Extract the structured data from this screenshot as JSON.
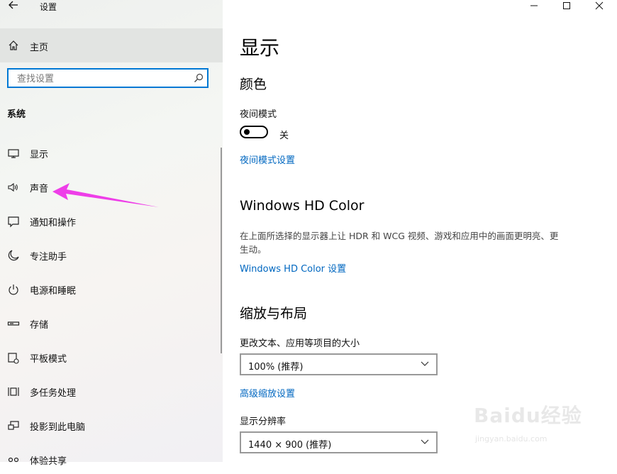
{
  "window": {
    "title": "设置",
    "controls": {
      "minimize": "minimize-icon",
      "maximize": "maximize-icon",
      "close": "close-icon"
    }
  },
  "sidebar": {
    "home": {
      "label": "主页",
      "icon": "home-icon"
    },
    "search": {
      "placeholder": "查找设置",
      "value": ""
    },
    "section": "系统",
    "items": [
      {
        "label": "显示",
        "icon": "monitor-icon"
      },
      {
        "label": "声音",
        "icon": "speaker-icon"
      },
      {
        "label": "通知和操作",
        "icon": "notification-icon"
      },
      {
        "label": "专注助手",
        "icon": "moon-icon"
      },
      {
        "label": "电源和睡眠",
        "icon": "power-icon"
      },
      {
        "label": "存储",
        "icon": "storage-icon"
      },
      {
        "label": "平板模式",
        "icon": "tablet-icon"
      },
      {
        "label": "多任务处理",
        "icon": "multitask-icon"
      },
      {
        "label": "投影到此电脑",
        "icon": "project-icon"
      },
      {
        "label": "体验共享",
        "icon": "share-icon"
      }
    ]
  },
  "main": {
    "title": "显示",
    "color_section": {
      "heading": "颜色",
      "night_light_label": "夜间模式",
      "toggle_state": "关",
      "toggle_on": false,
      "settings_link": "夜间模式设置"
    },
    "hd_section": {
      "heading": "Windows HD Color",
      "description": "在上面所选择的显示器上让 HDR 和 WCG 视频、游戏和应用中的画面更明亮、更生动。",
      "settings_link": "Windows HD Color 设置"
    },
    "scale_section": {
      "heading": "缩放与布局",
      "size_label": "更改文本、应用等项目的大小",
      "size_value": "100% (推荐)",
      "advanced_link": "高级缩放设置",
      "resolution_label": "显示分辨率",
      "resolution_value": "1440 × 900 (推荐)"
    }
  },
  "colors": {
    "accent": "#0078d4",
    "link": "#0067c0",
    "annotation_arrow": "#ee3ee8"
  },
  "watermark": {
    "main": "Baidu经验",
    "sub": "jingyan.baidu.com"
  }
}
